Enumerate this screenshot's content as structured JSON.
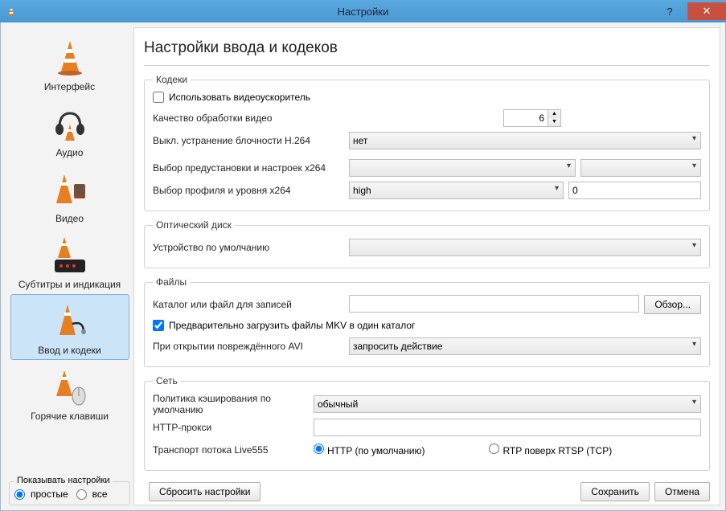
{
  "window": {
    "title": "Настройки",
    "help": "?",
    "close": "✕"
  },
  "sidebar": {
    "items": [
      {
        "label": "Интерфейс"
      },
      {
        "label": "Аудио"
      },
      {
        "label": "Видео"
      },
      {
        "label": "Субтитры и индикация"
      },
      {
        "label": "Ввод и кодеки"
      },
      {
        "label": "Горячие клавиши"
      }
    ],
    "show": {
      "legend": "Показывать настройки",
      "simple": "простые",
      "all": "все"
    }
  },
  "page": {
    "title": "Настройки ввода и кодеков",
    "codecs": {
      "legend": "Кодеки",
      "hw_accel": "Использовать видеоускоритель",
      "quality_label": "Качество обработки видео",
      "quality_value": "6",
      "h264_skip_label": "Выкл. устранение блочности H.264",
      "h264_skip_value": "нет",
      "x264_preset_label": "Выбор предустановки и настроек x264",
      "x264_preset_value": "",
      "x264_tune_value": "",
      "x264_profile_label": "Выбор профиля и уровня x264",
      "x264_profile_value": "high",
      "x264_level_value": "0"
    },
    "disc": {
      "legend": "Оптический диск",
      "device_label": "Устройство по умолчанию",
      "device_value": ""
    },
    "files": {
      "legend": "Файлы",
      "record_label": "Каталог или файл для записей",
      "record_value": "",
      "browse": "Обзор...",
      "preload_mkv": "Предварительно загрузить файлы MKV в один каталог",
      "damaged_avi_label": "При открытии повреждённого AVI",
      "damaged_avi_value": "запросить действие"
    },
    "network": {
      "legend": "Сеть",
      "cache_label": "Политика кэширования по умолчанию",
      "cache_value": "обычный",
      "proxy_label": "HTTP-прокси",
      "proxy_value": "",
      "live555_label": "Транспорт потока Live555",
      "live555_http": "HTTP (по умолчанию)",
      "live555_rtp": "RTP поверх RTSP (TCP)"
    }
  },
  "buttons": {
    "reset": "Сбросить настройки",
    "save": "Сохранить",
    "cancel": "Отмена"
  }
}
